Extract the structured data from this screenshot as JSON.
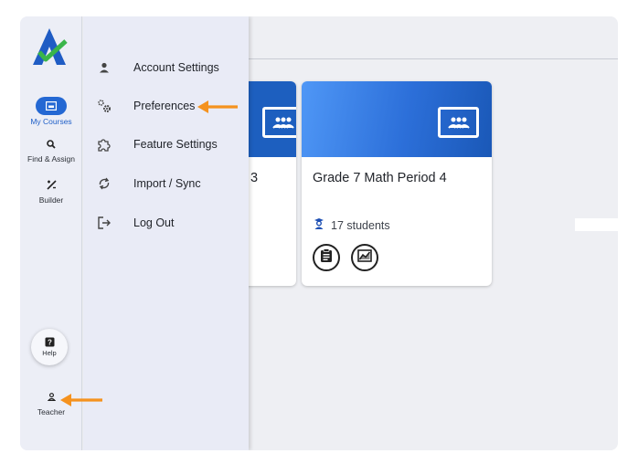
{
  "rail": {
    "items": [
      {
        "label": "My Courses",
        "icon": "courses-icon",
        "active": true
      },
      {
        "label": "Find & Assign",
        "icon": "search-icon"
      },
      {
        "label": "Builder",
        "icon": "builder-icon"
      }
    ],
    "help_label": "Help",
    "teacher_label": "Teacher"
  },
  "menu": {
    "items": [
      {
        "label": "Account Settings",
        "icon": "person-icon"
      },
      {
        "label": "Preferences",
        "icon": "gears-icon"
      },
      {
        "label": "Feature Settings",
        "icon": "puzzle-icon"
      },
      {
        "label": "Import / Sync",
        "icon": "sync-icon"
      },
      {
        "label": "Log Out",
        "icon": "logout-icon"
      }
    ]
  },
  "cards": [
    {
      "title_fragment": "3"
    },
    {
      "title": "Grade 7 Math Period 4",
      "students": "17 students"
    }
  ],
  "colors": {
    "accent": "#2468d3",
    "annotation_arrow": "#f5921e"
  }
}
